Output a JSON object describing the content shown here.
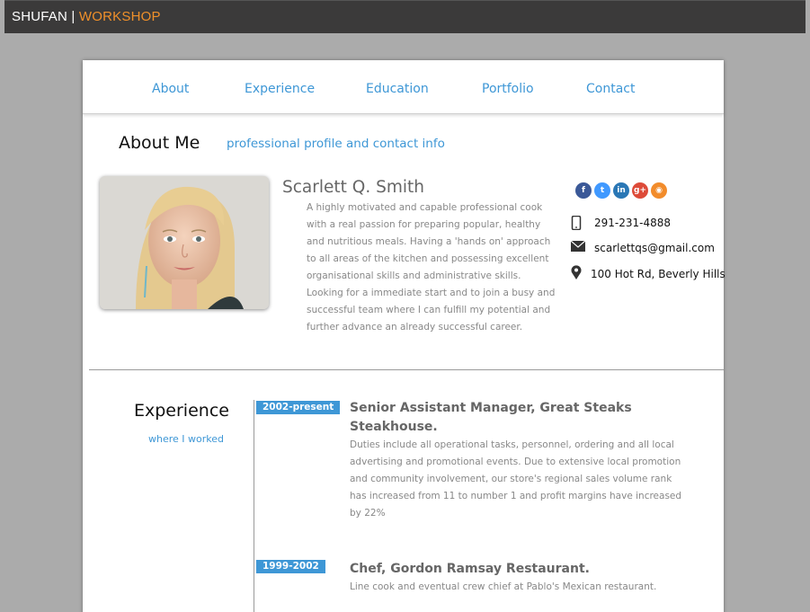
{
  "brand": {
    "part1": "SHUFAN",
    "separator": "|",
    "part2": "WORKSHOP"
  },
  "nav": {
    "about": "About",
    "experience": "Experience",
    "education": "Education",
    "portfolio": "Portfolio",
    "contact": "Contact"
  },
  "about": {
    "heading": "About Me",
    "subheading": "professional profile and contact info",
    "name": "Scarlett Q. Smith",
    "bio": "A highly motivated and capable professional cook with a real passion for preparing popular, healthy and nutritious meals. Having a 'hands on' approach to all areas of the kitchen and possessing excellent organisational skills and administrative skills. Looking for a immediate start and to join a busy and successful team where I can fulfill my potential and further advance an already successful career."
  },
  "social": [
    {
      "icon": "facebook-icon",
      "glyph": "f",
      "color": "#3b5998"
    },
    {
      "icon": "twitter-icon",
      "glyph": "t",
      "color": "#4099ff"
    },
    {
      "icon": "linkedin-icon",
      "glyph": "in",
      "color": "#2a77b5"
    },
    {
      "icon": "google-plus-icon",
      "glyph": "g+",
      "color": "#dd4b39"
    },
    {
      "icon": "rss-icon",
      "glyph": "◉",
      "color": "#f28c2b"
    }
  ],
  "contact": {
    "phone": "291-231-4888",
    "email": "scarlettqs@gmail.com",
    "address": "100 Hot Rd, Beverly Hills"
  },
  "experience": {
    "heading": "Experience",
    "subheading": "where I worked",
    "jobs": [
      {
        "years": "2002-present",
        "title": "Senior Assistant Manager, Great Steaks Steakhouse.",
        "description": "Duties include all operational tasks, personnel, ordering and all local advertising and promotional events. Due to extensive local promotion and community involvement, our store's regional sales volume rank has increased from 11 to number 1 and profit margins have increased by 22%"
      },
      {
        "years": "1999-2002",
        "title": "Chef, Gordon Ramsay Restaurant.",
        "description": "Line cook and eventual crew chief at Pablo's Mexican restaurant."
      }
    ]
  }
}
